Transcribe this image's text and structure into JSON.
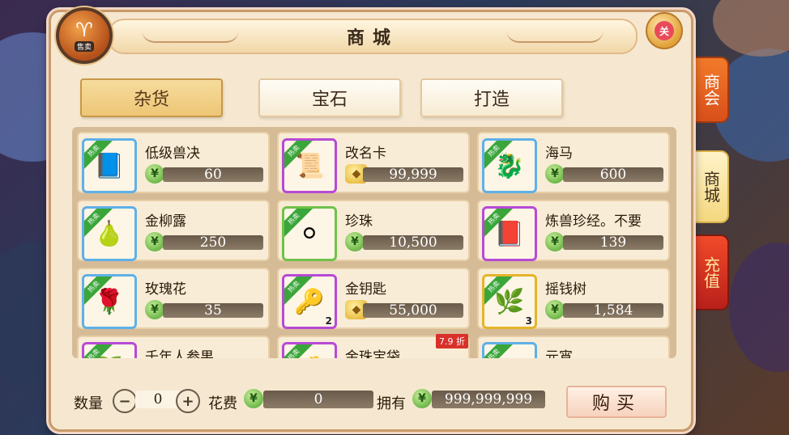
{
  "window": {
    "title": "商城",
    "badge_text": "售卖",
    "close_label": "关"
  },
  "tabs": [
    {
      "label": "杂货",
      "active": true
    },
    {
      "label": "宝石",
      "active": false
    },
    {
      "label": "打造",
      "active": false
    }
  ],
  "items": [
    {
      "name": "低级兽决",
      "price": "60",
      "currency": "green",
      "frame": "blue",
      "hot_label": "热卖",
      "icon": "book-icon",
      "glyph": "📘"
    },
    {
      "name": "改名卡",
      "price": "99,999",
      "currency": "gold",
      "frame": "purple",
      "hot_label": "热卖",
      "icon": "scroll-icon",
      "glyph": "📜"
    },
    {
      "name": "海马",
      "price": "600",
      "currency": "green",
      "frame": "blue",
      "hot_label": "热卖",
      "icon": "seahorse-icon",
      "glyph": "🐉"
    },
    {
      "name": "金柳露",
      "price": "250",
      "currency": "green",
      "frame": "blue",
      "hot_label": "热卖",
      "icon": "potion-icon",
      "glyph": "🍐"
    },
    {
      "name": "珍珠",
      "price": "10,500",
      "currency": "green",
      "frame": "green",
      "hot_label": "热卖",
      "icon": "pearl-icon",
      "glyph": "⚪"
    },
    {
      "name": "炼兽珍经。不要",
      "price": "139",
      "currency": "green",
      "frame": "purple",
      "hot_label": "热卖",
      "icon": "tome-icon",
      "glyph": "📕"
    },
    {
      "name": "玫瑰花",
      "price": "35",
      "currency": "green",
      "frame": "blue",
      "hot_label": "热卖",
      "icon": "rose-icon",
      "glyph": "🌹"
    },
    {
      "name": "金钥匙",
      "price": "55,000",
      "currency": "gold",
      "frame": "purple",
      "hot_label": "热卖",
      "icon": "key-icon",
      "glyph": "🔑",
      "quantity": "2"
    },
    {
      "name": "摇钱树",
      "price": "1,584",
      "currency": "green",
      "frame": "gold",
      "hot_label": "热卖",
      "icon": "money-tree-icon",
      "glyph": "🌿",
      "quantity": "3"
    },
    {
      "name": "千年人参果",
      "price": "",
      "currency": "green",
      "frame": "purple",
      "hot_label": "热卖",
      "icon": "ginseng-fruit-icon",
      "glyph": "🍑"
    },
    {
      "name": "金珠宝袋",
      "price": "",
      "currency": "gold",
      "frame": "purple",
      "hot_label": "热卖",
      "icon": "treasure-bag-icon",
      "glyph": "💰",
      "discount": "7.9 折"
    },
    {
      "name": "元宵",
      "price": "",
      "currency": "green",
      "frame": "blue",
      "hot_label": "热卖",
      "icon": "rice-ball-icon",
      "glyph": "⚪"
    }
  ],
  "bottom": {
    "quantity_label": "数量",
    "minus": "−",
    "plus": "+",
    "quantity_value": "0",
    "cost_label": "花费",
    "cost_value": "0",
    "own_label": "拥有",
    "own_value": "999,999,999",
    "buy_label": "购买"
  },
  "side_tabs": [
    "商会",
    "商城",
    "充值"
  ]
}
